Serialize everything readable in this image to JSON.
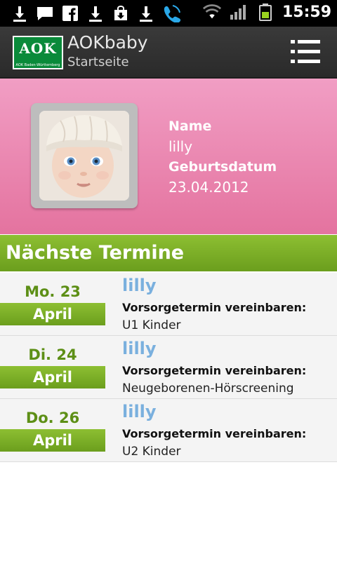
{
  "status_bar": {
    "time": "15:59",
    "icons": [
      "download-icon",
      "chat-icon",
      "facebook-icon",
      "download-icon",
      "bag-icon",
      "download-icon",
      "call-icon",
      "wifi-icon",
      "signal-icon",
      "battery-icon"
    ]
  },
  "app_bar": {
    "title": "AOKbaby",
    "subtitle": "Startseite",
    "logo_text": "AOK",
    "logo_subtext": "AOK Baden-Württemberg"
  },
  "profile": {
    "name_label": "Name",
    "name_value": "lilly",
    "birth_label": "Geburtsdatum",
    "birth_value": "23.04.2012"
  },
  "section": {
    "title": "Nächste Termine"
  },
  "appointments": [
    {
      "day": "Mo. 23",
      "month": "April",
      "name": "lilly",
      "type": "Vorsorgetermin vereinbaren:",
      "detail": "U1 Kinder"
    },
    {
      "day": "Di. 24",
      "month": "April",
      "name": "lilly",
      "type": "Vorsorgetermin vereinbaren:",
      "detail": "Neugeborenen-Hörscreening"
    },
    {
      "day": "Do. 26",
      "month": "April",
      "name": "lilly",
      "type": "Vorsorgetermin vereinbaren:",
      "detail": "U2 Kinder"
    }
  ],
  "colors": {
    "accent_green": "#7aad25",
    "profile_pink": "#ea86b1",
    "name_blue": "#7ab0de",
    "bar_dark": "#333333"
  }
}
